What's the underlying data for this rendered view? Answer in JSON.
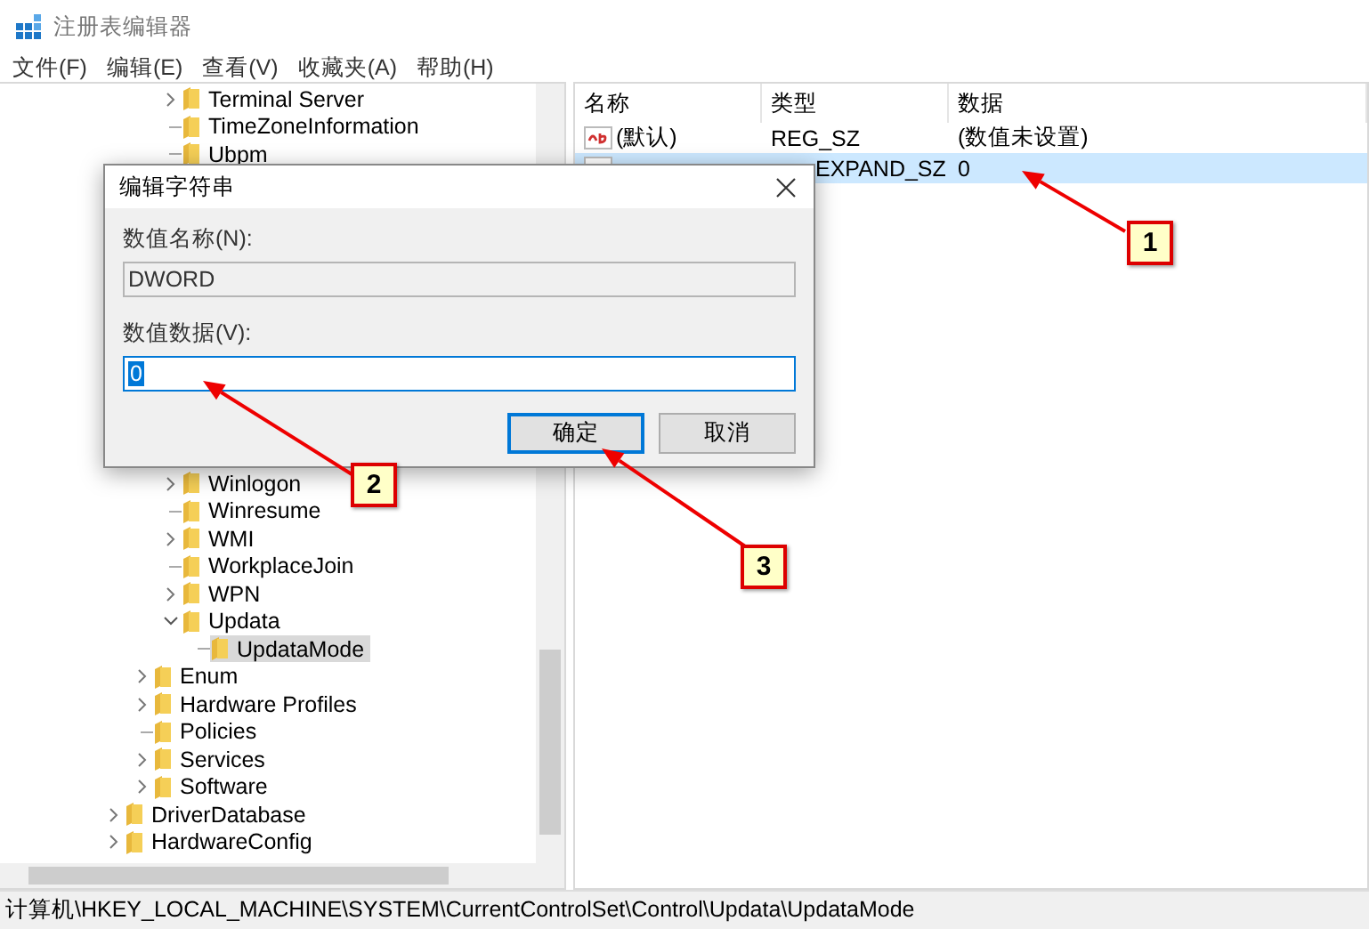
{
  "window": {
    "title": "注册表编辑器"
  },
  "menu": [
    "文件(F)",
    "编辑(E)",
    "查看(V)",
    "收藏夹(A)",
    "帮助(H)"
  ],
  "tree": {
    "items": [
      {
        "expanded": true,
        "children": [
          {
            "expanded": true,
            "children": [
              {
                "label": "Terminal Server",
                "expandable": true,
                "expanded": false,
                "selected": false
              },
              {
                "label": "TimeZoneInformation",
                "expandable": false,
                "selected": false
              },
              {
                "label": "Ubpm",
                "expandable": false,
                "selected": false
              },
              {
                "label": "Winlogon",
                "expandable": true,
                "expanded": false,
                "selected": false
              },
              {
                "label": "Winresume",
                "expandable": false,
                "selected": false
              },
              {
                "label": "WMI",
                "expandable": true,
                "expanded": false,
                "selected": false
              },
              {
                "label": "WorkplaceJoin",
                "expandable": false,
                "selected": false
              },
              {
                "label": "WPN",
                "expandable": true,
                "expanded": false,
                "selected": false
              },
              {
                "label": "Updata",
                "expandable": true,
                "expanded": true,
                "selected": false,
                "children": [
                  {
                    "label": "UpdataMode",
                    "expandable": false,
                    "selected": true
                  }
                ]
              }
            ]
          },
          {
            "label": "Enum",
            "expandable": true,
            "expanded": false,
            "selected": false
          },
          {
            "label": "Hardware Profiles",
            "expandable": true,
            "expanded": false,
            "selected": false
          },
          {
            "label": "Policies",
            "expandable": false,
            "selected": false
          },
          {
            "label": "Services",
            "expandable": true,
            "expanded": false,
            "selected": false
          },
          {
            "label": "Software",
            "expandable": true,
            "expanded": false,
            "selected": false
          }
        ]
      },
      {
        "label": "DriverDatabase",
        "expandable": true,
        "expanded": false,
        "selected": false
      },
      {
        "label": "HardwareConfig",
        "expandable": true,
        "expanded": false,
        "selected": false
      }
    ]
  },
  "values": {
    "columns": [
      "名称",
      "类型",
      "数据"
    ],
    "rows": [
      {
        "name": "(默认)",
        "type": "REG_SZ",
        "data": "(数值未设置)",
        "selected": false
      },
      {
        "type": "EXPAND_SZ",
        "data": "0",
        "selected": true
      }
    ]
  },
  "dialog": {
    "title": "编辑字符串",
    "name_label": "数值名称(N):",
    "name_value": "DWORD",
    "data_label": "数值数据(V):",
    "data_value": "0",
    "data_text_selected": true,
    "buttons": [
      {
        "label": "确定",
        "default": true
      },
      {
        "label": "取消",
        "default": false
      }
    ]
  },
  "annotations": [
    "1",
    "2",
    "3"
  ],
  "status_bar": "计算机\\HKEY_LOCAL_MACHINE\\SYSTEM\\CurrentControlSet\\Control\\Updata\\UpdataMode"
}
